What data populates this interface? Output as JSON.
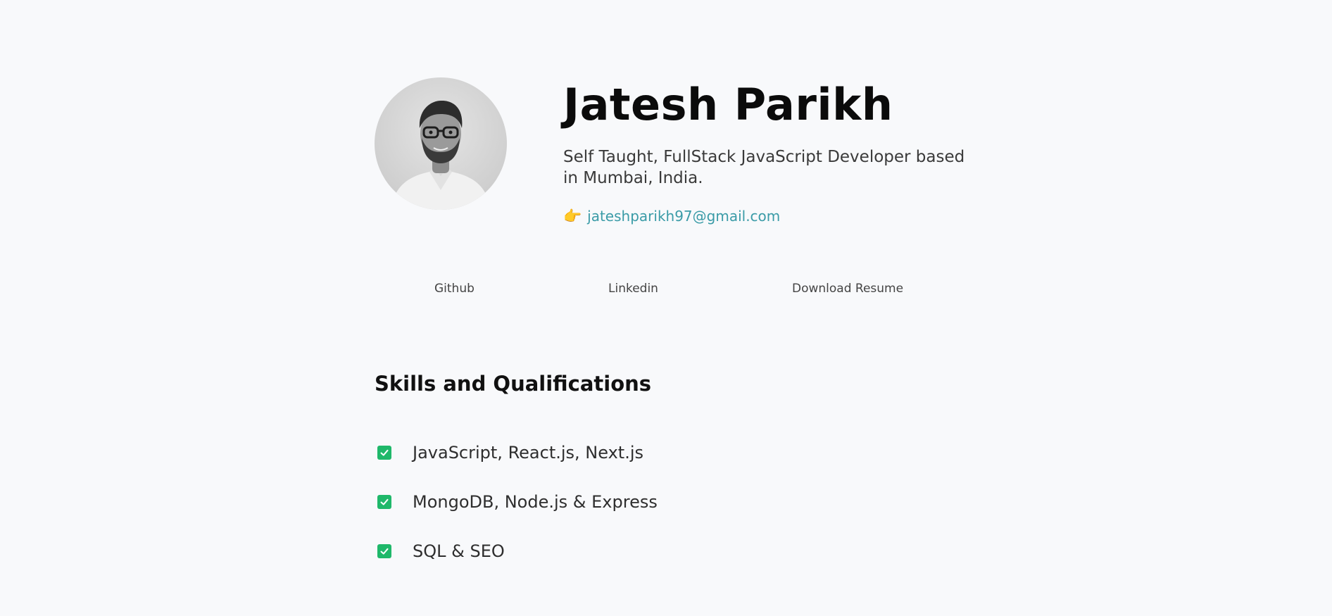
{
  "profile": {
    "name": "Jatesh Parikh",
    "tagline": "Self Taught, FullStack JavaScript Developer based in Mumbai, India.",
    "email_icon": "pointing-hand-icon",
    "email": "jateshparikh97@gmail.com",
    "avatar": "profile-photo-grayscale"
  },
  "links": {
    "github": "Github",
    "linkedin": "Linkedin",
    "resume": "Download Resume"
  },
  "skills": {
    "title": "Skills and Qualifications",
    "check_icon": "checkbox-checked-icon",
    "check_color": "#1fb86a",
    "items": [
      {
        "label": "JavaScript, React.js, Next.js"
      },
      {
        "label": "MongoDB, Node.js & Express"
      },
      {
        "label": "SQL & SEO"
      }
    ]
  },
  "colors": {
    "background": "#f8f9fb",
    "link": "#3a9ba7",
    "heading": "#0b0b0b"
  }
}
